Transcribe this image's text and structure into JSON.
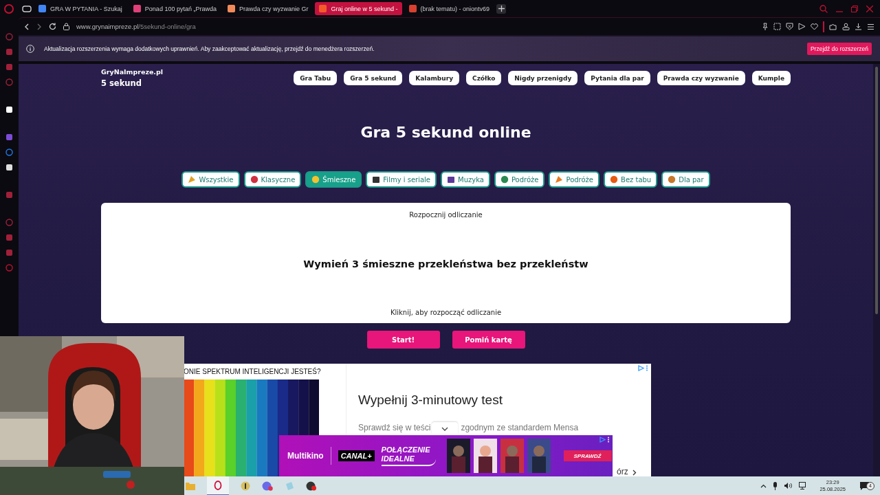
{
  "browser": {
    "tabs": [
      {
        "title": "GRA W PYTANIA - Szukaj",
        "selected": false
      },
      {
        "title": "Ponad 100 pytań „Prawda",
        "selected": false
      },
      {
        "title": "Prawda czy wyzwanie Gr",
        "selected": false
      },
      {
        "title": "Graj online w 5 sekund -",
        "selected": true
      },
      {
        "title": "(brak tematu) - oniontv69",
        "selected": false
      }
    ],
    "address": {
      "host": "www.grynaimpreze.pl",
      "path": "/5sekund-online/gra"
    },
    "notification": {
      "message": "Aktualizacja rozszerzenia wymaga dodatkowych uprawnień. Aby zaakceptować aktualizację, przejdź do menedżera rozszerzeń.",
      "button": "Przejdź do rozszerzeń"
    }
  },
  "site": {
    "brand": "GryNaImpreze.pl",
    "subtitle": "5 sekund",
    "nav": [
      "Gra Tabu",
      "Gra 5 sekund",
      "Kalambury",
      "Czółko",
      "Nigdy przenigdy",
      "Pytania dla par",
      "Prawda czy wyzwanie",
      "Kumple"
    ],
    "heading": "Gra 5 sekund online",
    "categories": [
      {
        "label": "Wszystkie",
        "selected": false
      },
      {
        "label": "Klasyczne",
        "selected": false
      },
      {
        "label": "Śmieszne",
        "selected": true
      },
      {
        "label": "Filmy i seriale",
        "selected": false
      },
      {
        "label": "Muzyka",
        "selected": false
      },
      {
        "label": "Podróże",
        "selected": false
      },
      {
        "label": "Podróże",
        "selected": false
      },
      {
        "label": "Bez tabu",
        "selected": false
      },
      {
        "label": "Dla par",
        "selected": false
      }
    ],
    "card": {
      "top": "Rozpocznij odliczanie",
      "question": "Wymień 3 śmieszne przekleństwa bez przekleństw",
      "hint": "Kliknij, aby rozpocząć odliczanie"
    },
    "buttons": [
      "Start!",
      "Pomiń kartę"
    ]
  },
  "ad": {
    "image_heading": "ONIE SPEKTRUM INTELIGENCJI JESTEŚ?",
    "title": "Wypełnij 3-minutowy test",
    "text_before": "Sprawdź się w teści",
    "text_after": "zgodnym ze standardem Mensa",
    "link": "órz"
  },
  "banner": {
    "brand": "Multikino",
    "channel": "CANAL+",
    "slogan": [
      "POŁĄCZENIE",
      "IDEALNE"
    ],
    "cta": "SPRAWDŹ"
  },
  "taskbar": {
    "time": "23:29",
    "date": "25.08.2025",
    "notifications": "4"
  }
}
